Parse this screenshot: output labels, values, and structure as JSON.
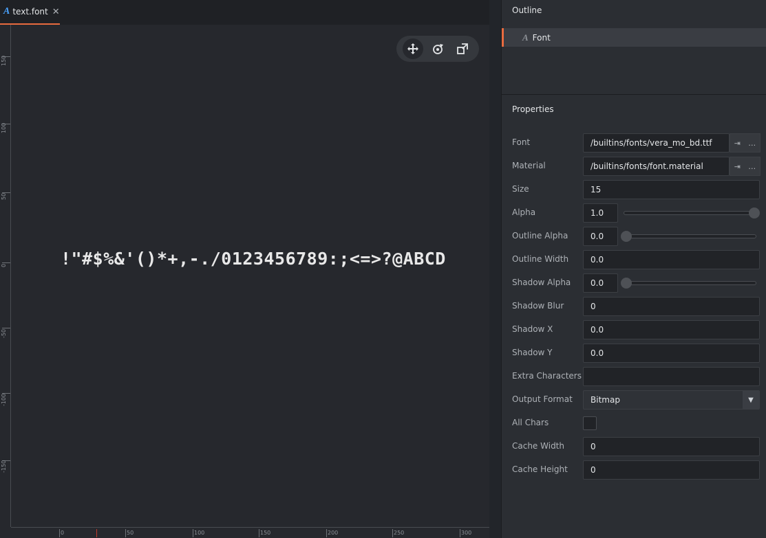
{
  "tab": {
    "icon": "font-file-icon",
    "title": "text.font",
    "close": "✕"
  },
  "viewport": {
    "preview_text": "!\"#$%&'()*+,-./0123456789:;<=>?@ABCD",
    "ruler_v_labels": [
      "150",
      "100",
      "50",
      "0",
      "-50",
      "-100",
      "-150"
    ],
    "ruler_h_labels": [
      "0",
      "50",
      "100",
      "150",
      "200",
      "250",
      "300"
    ],
    "tools": [
      {
        "name": "move-tool-icon",
        "glyph": "✥"
      },
      {
        "name": "rotate-tool-icon",
        "glyph": "⟳"
      },
      {
        "name": "scale-tool-icon",
        "glyph": "⤢"
      }
    ]
  },
  "outline": {
    "title": "Outline",
    "items": [
      {
        "icon": "font-icon",
        "label": "Font"
      }
    ]
  },
  "properties": {
    "title": "Properties",
    "font": {
      "label": "Font",
      "value": "/builtins/fonts/vera_mo_bd.ttf"
    },
    "material": {
      "label": "Material",
      "value": "/builtins/fonts/font.material"
    },
    "size": {
      "label": "Size",
      "value": "15"
    },
    "alpha": {
      "label": "Alpha",
      "value": "1.0",
      "level": 1.0
    },
    "outline_alpha": {
      "label": "Outline Alpha",
      "value": "0.0",
      "level": 0.0
    },
    "outline_width": {
      "label": "Outline Width",
      "value": "0.0"
    },
    "shadow_alpha": {
      "label": "Shadow Alpha",
      "value": "0.0",
      "level": 0.0
    },
    "shadow_blur": {
      "label": "Shadow Blur",
      "value": "0"
    },
    "shadow_x": {
      "label": "Shadow X",
      "value": "0.0"
    },
    "shadow_y": {
      "label": "Shadow Y",
      "value": "0.0"
    },
    "extra_characters": {
      "label": "Extra Characters",
      "value": ""
    },
    "output_format": {
      "label": "Output Format",
      "value": "Bitmap"
    },
    "all_chars": {
      "label": "All Chars",
      "checked": false
    },
    "cache_width": {
      "label": "Cache Width",
      "value": "0"
    },
    "cache_height": {
      "label": "Cache Height",
      "value": "0"
    },
    "resource_buttons": {
      "goto": "⇥",
      "browse": "…"
    }
  },
  "colors": {
    "accent": "#e96b3f",
    "font_icon": "#4aa3ff",
    "panel_bg": "#2b2e33",
    "viewport_bg": "#26282d"
  }
}
